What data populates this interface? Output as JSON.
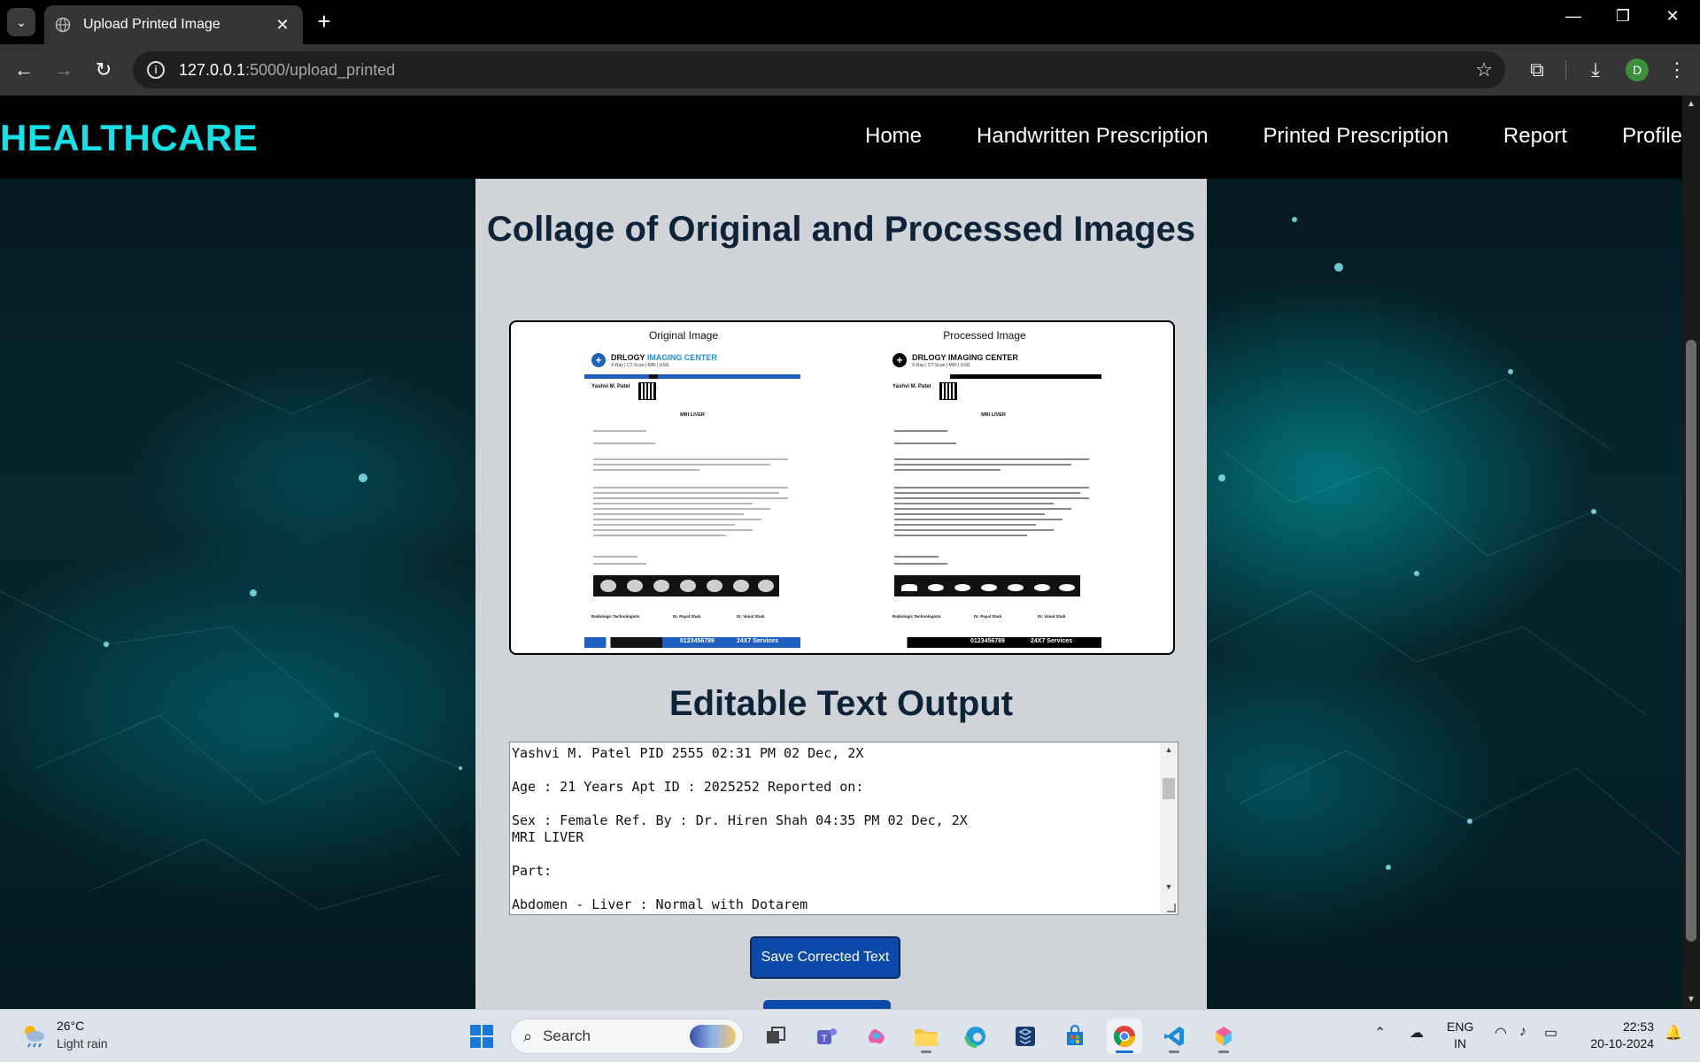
{
  "browser": {
    "tab_title": "Upload Printed Image",
    "url_host": "127.0.0.1",
    "url_path": ":5000/upload_printed",
    "profile_initial": "D"
  },
  "site": {
    "brand": "HEALTHCARE",
    "nav": [
      "Home",
      "Handwritten Prescription",
      "Printed Prescription",
      "Report",
      "Profile"
    ]
  },
  "main": {
    "collage_heading": "Collage of Original and Processed Images",
    "original_caption": "Original Image",
    "processed_caption": "Processed Image",
    "output_heading": "Editable Text Output",
    "text_output": "Yashvi M. Patel PID 2555 02:31 PM 02 Dec, 2X\n\nAge : 21 Years Apt ID : 2025252 Reported on:\n\nSex : Female Ref. By : Dr. Hiren Shah 04:35 PM 02 Dec, 2X\nMRI LIVER\n\nPart:\n\nAbdomen - Liver : Normal with Dotarem",
    "save_button": "Save Corrected Text"
  },
  "report_preview": {
    "org_name_prefix": "DRLOGY",
    "org_name_accent": "IMAGING CENTER",
    "org_services": "X-Ray | CT-Scan | MRI | USG",
    "patient_name": "Yashvi M. Patel",
    "exam_title": "MRI LIVER",
    "phone": "0123456789",
    "service_hours": "24X7 Services",
    "signatories": [
      "Radiologic Technologists",
      "Dr. Payal Shah",
      "Dr. Vimal Shah"
    ],
    "brand_color": "#1f5fbf",
    "accent_color": "#1f8fe0",
    "processed_color": "#000000"
  },
  "taskbar": {
    "temperature": "26°C",
    "weather": "Light rain",
    "search_placeholder": "Search",
    "lang_line1": "ENG",
    "lang_line2": "IN",
    "time": "22:53",
    "date": "20-10-2024"
  },
  "colors": {
    "brand": "#16e0e6",
    "panel_bg": "#d0d4d8",
    "heading": "#0e2238",
    "button": "#0b4aa8"
  }
}
